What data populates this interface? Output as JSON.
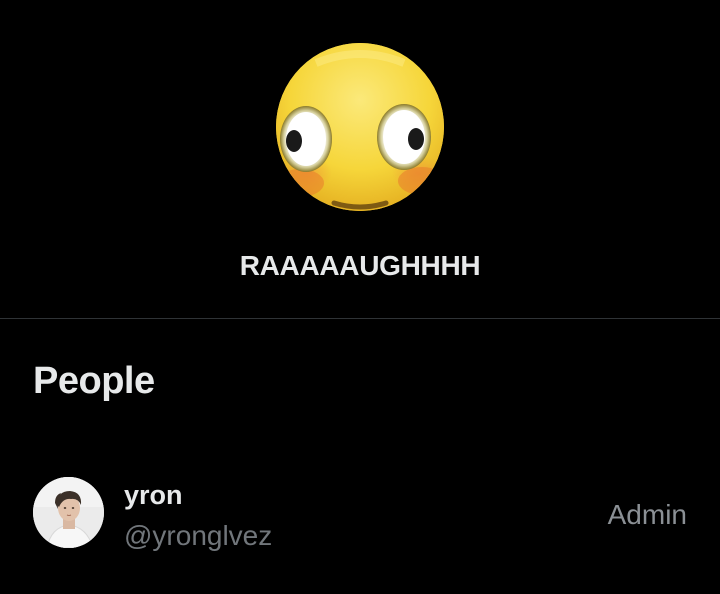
{
  "group": {
    "avatar_icon": "flushed-emoji-icon",
    "name": "RAAAAAUGHHHH"
  },
  "people_section": {
    "title": "People",
    "members": [
      {
        "avatar_icon": "user-photo-avatar",
        "display_name": "yron",
        "handle": "@yronglvez",
        "role": "Admin"
      }
    ]
  },
  "colors": {
    "background": "#000000",
    "primary_text": "#e7e9ea",
    "secondary_text": "#71767b",
    "divider": "#2f3336"
  }
}
